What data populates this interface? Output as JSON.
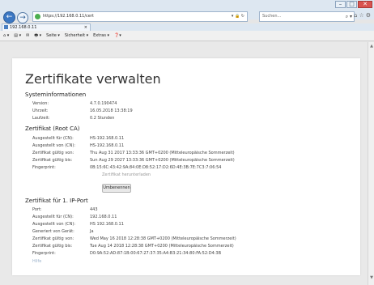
{
  "browser": {
    "url": "https://192.168.0.11/cert",
    "search_placeholder": "Suchen...",
    "tab_title": "192.168.0.11",
    "menu": {
      "page": "Seite ▾",
      "security": "Sicherheit ▾",
      "extras": "Extras ▾"
    }
  },
  "page": {
    "title": "Zertifikate verwalten",
    "system": {
      "heading": "Systeminformationen",
      "rows": [
        {
          "label": "Version:",
          "value": "4.7.0.190474"
        },
        {
          "label": "Uhrzeit:",
          "value": "16.05.2018 13:38:19"
        },
        {
          "label": "Laufzeit:",
          "value": "0.2 Stunden"
        }
      ]
    },
    "rootca": {
      "heading": "Zertifikat (Root CA)",
      "rows": [
        {
          "label": "Ausgestellt für (CN):",
          "value": "HS-192.168.0.11"
        },
        {
          "label": "Ausgestellt von (CN):",
          "value": "HS-192.168.0.11"
        },
        {
          "label": "Zertifikat gültig von:",
          "value": "Thu Aug 31 2017 13:33:36 GMT+0200 (Mitteleuropäische Sommerzeit)"
        },
        {
          "label": "Zertifikat gültig bis:",
          "value": "Sun Aug 29 2027 13:33:36 GMT+0200 (Mitteleuropäische Sommerzeit)"
        },
        {
          "label": "Fingerprint:",
          "value": "0B:15:6C:43:42:9A:84:0E:D8:52:17:D2:6D:4E:3B:7E:7C3:7:06:54"
        }
      ],
      "download_link": "Zertifikat herunterladen",
      "remove_button": "Umbenennen"
    },
    "ipport": {
      "heading": "Zertifikat für 1. IP-Port",
      "rows": [
        {
          "label": "Port:",
          "value": "443"
        },
        {
          "label": "Ausgestellt für (CN):",
          "value": "192.168.0.11"
        },
        {
          "label": "Ausgestellt von (CN):",
          "value": "HS 192.168.0.11"
        },
        {
          "label": "Generiert von Gerät:",
          "value": "Ja"
        },
        {
          "label": "Zertifikat gültig von:",
          "value": "Wed May 16 2018 12:28:38 GMT+0200 (Mitteleuropäische Sommerzeit)"
        },
        {
          "label": "Zertifikat gültig bis:",
          "value": "Tue Aug 14 2018 12:28:38 GMT+0200 (Mitteleuropäische Sommerzeit)"
        },
        {
          "label": "Fingerprint:",
          "value": "D0:9A:52:AD:87:1B:00:67:27:37:35:A4:B3:21:34:80:FA:52:D4:3B"
        }
      ],
      "footer_link": "Hilfe"
    }
  }
}
